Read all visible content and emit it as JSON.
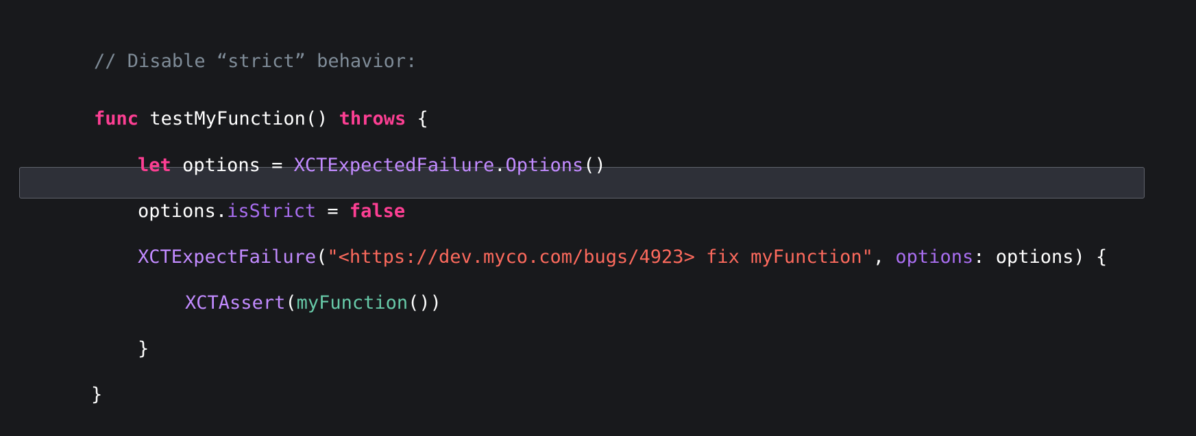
{
  "comment": "// Disable “strict” behavior:",
  "lines": {
    "l1": {
      "kw_func": "func",
      "name": " testMyFunction() ",
      "kw_throws": "throws",
      "brace": " {"
    },
    "l2": {
      "kw_let": "let",
      "mid": " options = ",
      "type": "XCTExpectedFailure",
      "dot": ".",
      "member": "Options",
      "parens": "()"
    },
    "l3": {
      "obj": "options.",
      "prop": "isStrict",
      "eq": " = ",
      "kw_false": "false"
    },
    "l4": {
      "fn": "XCTExpectFailure",
      "open": "(",
      "str": "\"<https://dev.myco.com/bugs/4923> fix myFunction\"",
      "comma": ", ",
      "label": "options",
      "rest": ": options) {"
    },
    "l5": {
      "fn": "XCTAssert",
      "open": "(",
      "call": "myFunction",
      "close": "())"
    },
    "l6": {
      "brace": "}"
    },
    "l7": {
      "brace": "}"
    }
  },
  "colors": {
    "background": "#18191c",
    "keyword": "#fc3f93",
    "type": "#c28bff",
    "string": "#fc6a5d",
    "function": "#67c9a8",
    "comment": "#7f8c98",
    "highlight": "#2e3038"
  }
}
